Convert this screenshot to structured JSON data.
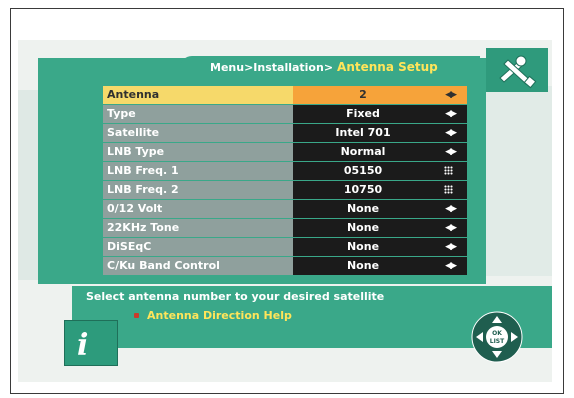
{
  "header": {
    "breadcrumb_path": "Menu>Installation>",
    "page_title": "Antenna Setup",
    "logo_icon": "tools-icon"
  },
  "menu": {
    "items": [
      {
        "label": "Antenna",
        "value": "2",
        "control": "left-right-arrows-icon",
        "selected": true
      },
      {
        "label": "Type",
        "value": "Fixed",
        "control": "left-right-arrows-icon"
      },
      {
        "label": "Satellite",
        "value": "Intel 701",
        "control": "left-right-arrows-icon"
      },
      {
        "label": "LNB Type",
        "value": "Normal",
        "control": "left-right-arrows-icon"
      },
      {
        "label": "LNB Freq. 1",
        "value": "05150",
        "control": "keypad-icon"
      },
      {
        "label": "LNB Freq. 2",
        "value": "10750",
        "control": "keypad-icon"
      },
      {
        "label": "0/12 Volt",
        "value": "None",
        "control": "left-right-arrows-icon"
      },
      {
        "label": "22KHz Tone",
        "value": "None",
        "control": "left-right-arrows-icon"
      },
      {
        "label": "DiSEqC",
        "value": "None",
        "control": "left-right-arrows-icon"
      },
      {
        "label": "C/Ku Band Control",
        "value": "None",
        "control": "left-right-arrows-icon"
      }
    ]
  },
  "help": {
    "main_text": "Select antenna number to your desired satellite",
    "sub_text": "Antenna Direction Help",
    "info_icon": "info-icon",
    "nav_icon": "ok-list-navigation-pad-icon",
    "nav_center_label_1": "OK",
    "nav_center_label_2": "LIST"
  },
  "colors": {
    "panel": "#3aa889",
    "selected_label": "#f6d96a",
    "selected_value": "#f6a33a",
    "row_label": "#8fa09d",
    "row_value": "#1b1b1b",
    "title_yellow": "#ffe55a"
  }
}
